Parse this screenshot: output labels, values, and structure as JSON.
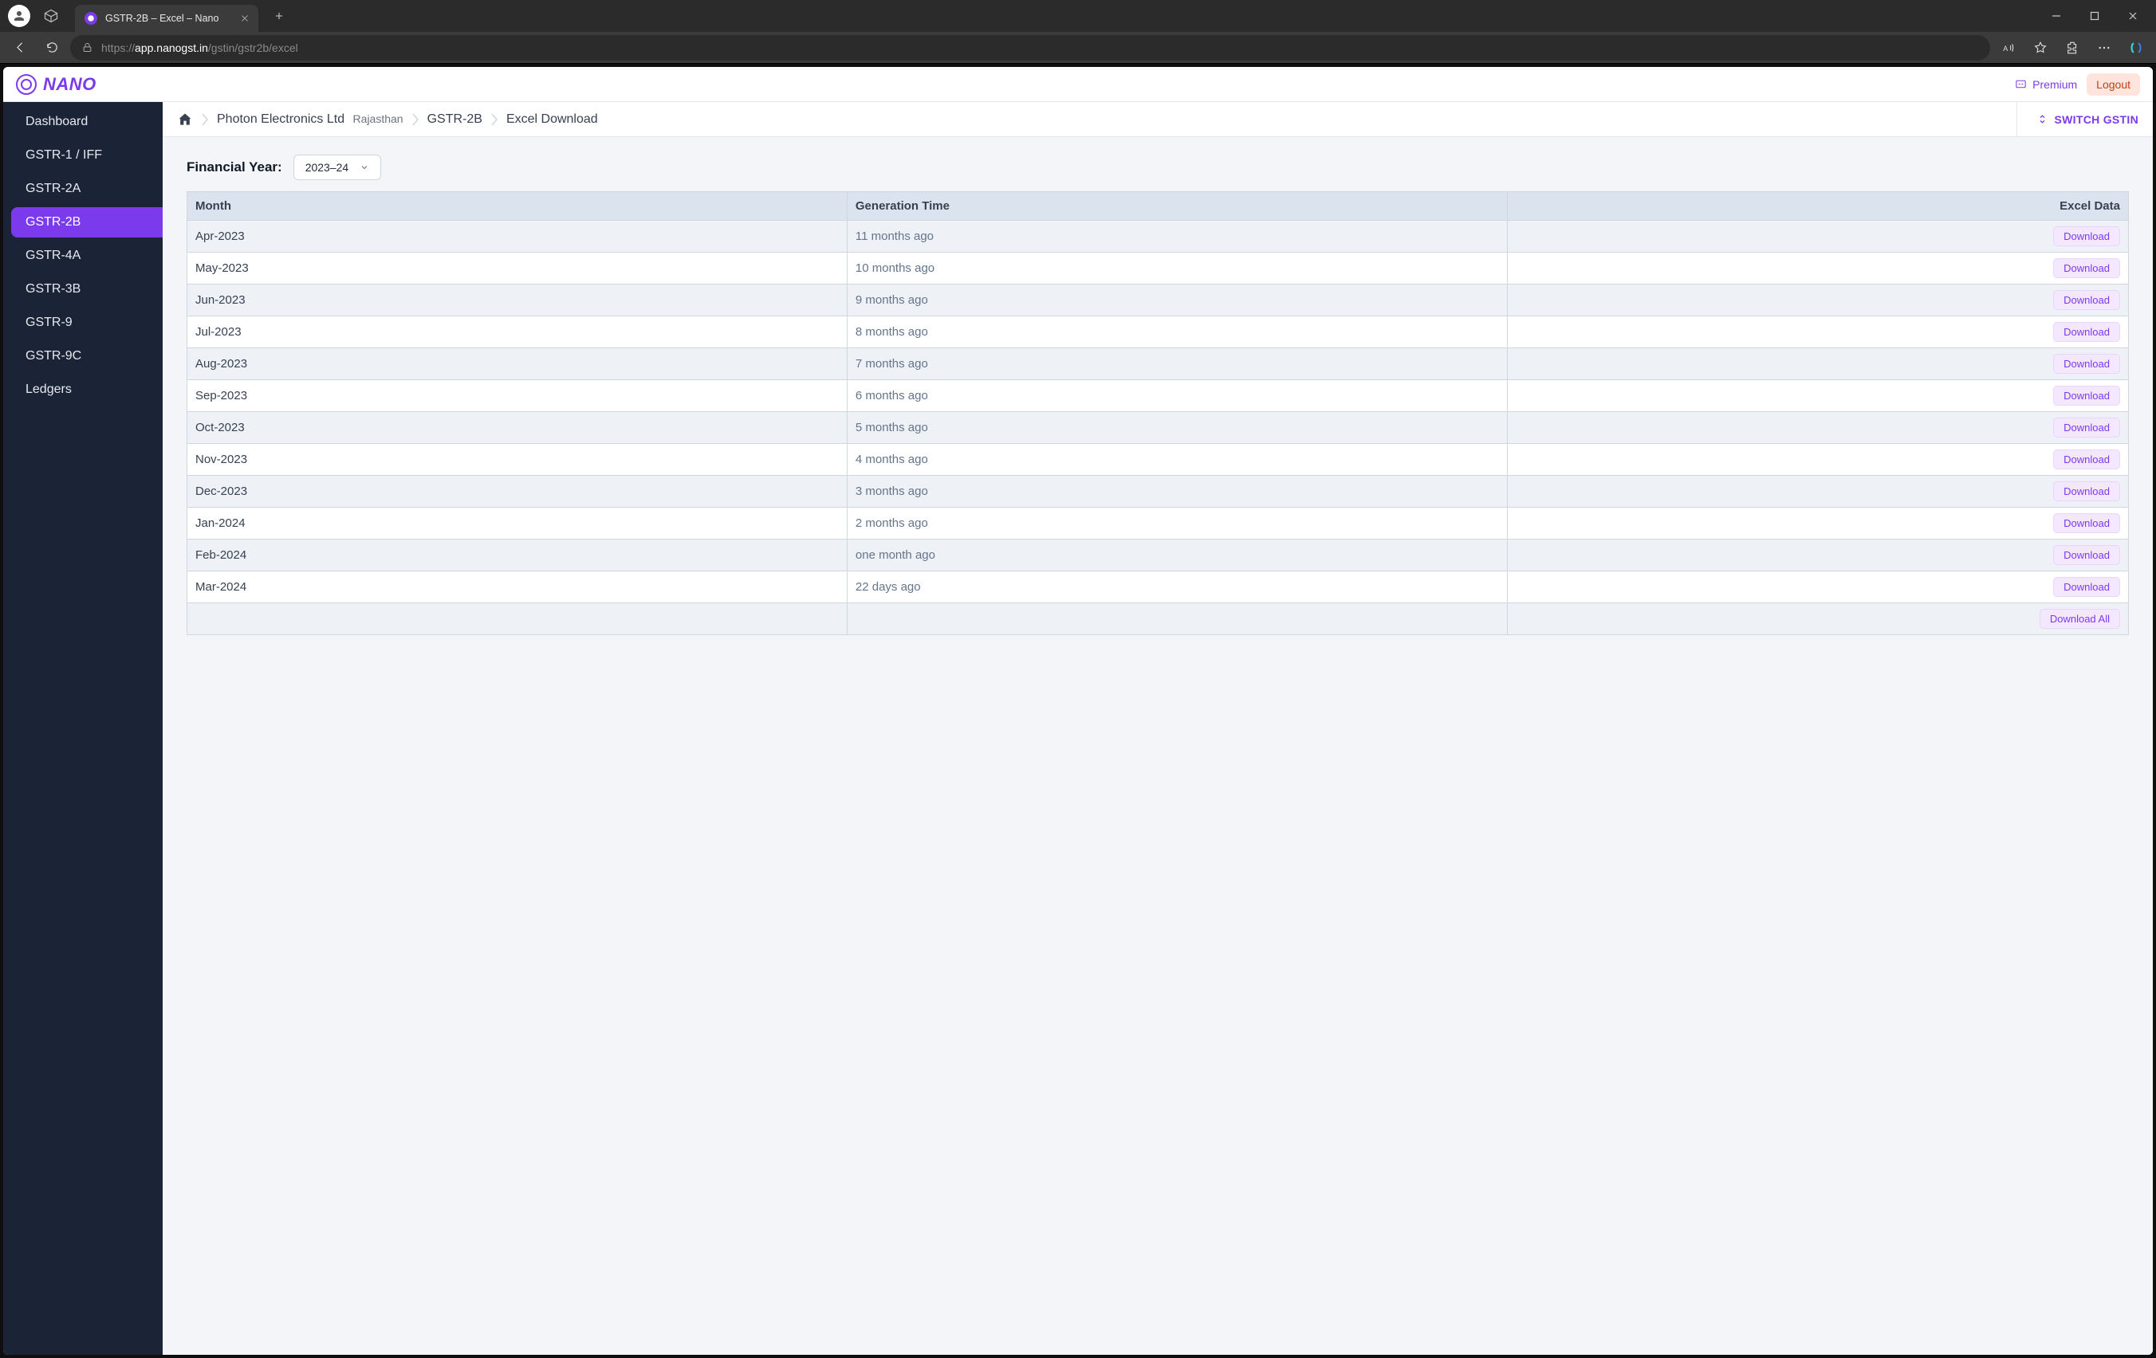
{
  "browser": {
    "tab_title": "GSTR-2B – Excel – Nano",
    "url_dim_prefix": "https://",
    "url_host": "app.nanogst.in",
    "url_path": "/gstin/gstr2b/excel"
  },
  "brand": {
    "name": "NANO"
  },
  "header": {
    "premium_label": "Premium",
    "logout_label": "Logout"
  },
  "sidebar": {
    "items": [
      {
        "label": "Dashboard",
        "active": false
      },
      {
        "label": "GSTR-1 / IFF",
        "active": false
      },
      {
        "label": "GSTR-2A",
        "active": false
      },
      {
        "label": "GSTR-2B",
        "active": true
      },
      {
        "label": "GSTR-4A",
        "active": false
      },
      {
        "label": "GSTR-3B",
        "active": false
      },
      {
        "label": "GSTR-9",
        "active": false
      },
      {
        "label": "GSTR-9C",
        "active": false
      },
      {
        "label": "Ledgers",
        "active": false
      }
    ]
  },
  "breadcrumb": {
    "company": "Photon Electronics Ltd",
    "state": "Rajasthan",
    "section": "GSTR-2B",
    "page": "Excel Download",
    "switch_label": "SWITCH GSTIN"
  },
  "fy": {
    "label": "Financial Year:",
    "selected": "2023–24"
  },
  "table": {
    "columns": {
      "month": "Month",
      "gen": "Generation Time",
      "excel": "Excel Data"
    },
    "download_label": "Download",
    "download_all_label": "Download All",
    "rows": [
      {
        "month": "Apr-2023",
        "gen": "11 months ago"
      },
      {
        "month": "May-2023",
        "gen": "10 months ago"
      },
      {
        "month": "Jun-2023",
        "gen": "9 months ago"
      },
      {
        "month": "Jul-2023",
        "gen": "8 months ago"
      },
      {
        "month": "Aug-2023",
        "gen": "7 months ago"
      },
      {
        "month": "Sep-2023",
        "gen": "6 months ago"
      },
      {
        "month": "Oct-2023",
        "gen": "5 months ago"
      },
      {
        "month": "Nov-2023",
        "gen": "4 months ago"
      },
      {
        "month": "Dec-2023",
        "gen": "3 months ago"
      },
      {
        "month": "Jan-2024",
        "gen": "2 months ago"
      },
      {
        "month": "Feb-2024",
        "gen": "one month ago"
      },
      {
        "month": "Mar-2024",
        "gen": "22 days ago"
      }
    ]
  }
}
